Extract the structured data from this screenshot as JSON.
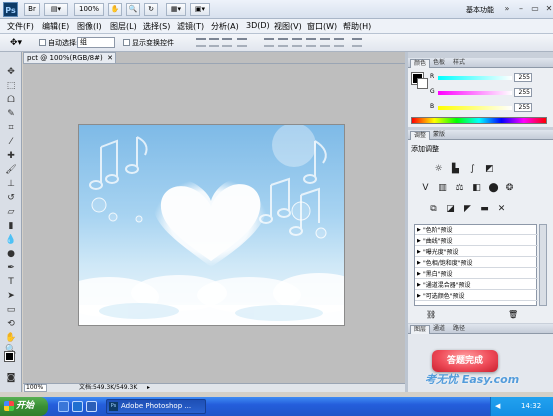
{
  "app": {
    "logo_text": "Ps",
    "zoom_select": "100%",
    "workspace_label": "基本功能"
  },
  "menu": [
    "文件(F)",
    "编辑(E)",
    "图像(I)",
    "图层(L)",
    "选择(S)",
    "滤镜(T)",
    "分析(A)",
    "3D(D)",
    "视图(V)",
    "窗口(W)",
    "帮助(H)"
  ],
  "options": {
    "auto_select_label": "自动选择:",
    "auto_select_value": "组",
    "show_transform_label": "显示变换控件"
  },
  "document": {
    "tab_label": "pct @ 100%(RGB/8#)",
    "status_zoom": "100%",
    "status_doc": "文档:549.3K/549.3K"
  },
  "color_panel": {
    "tabs": [
      "颜色",
      "色板",
      "样式"
    ],
    "channels": [
      {
        "label": "R",
        "value": "255"
      },
      {
        "label": "G",
        "value": "255"
      },
      {
        "label": "B",
        "value": "255"
      }
    ]
  },
  "adjust_panel": {
    "tabs": [
      "调整",
      "蒙版"
    ],
    "title": "添加调整",
    "presets": [
      "\"色阶\"预设",
      "\"曲线\"预设",
      "\"曝光度\"预设",
      "\"色相/饱和度\"预设",
      "\"黑白\"预设",
      "\"通道混合器\"预设",
      "\"可选颜色\"预设"
    ]
  },
  "layers_panel": {
    "tabs": [
      "图层",
      "通道",
      "路径"
    ]
  },
  "overlay": {
    "done_button": "答题完成",
    "watermark": "考无忧 Easy.com"
  },
  "taskbar": {
    "start": "开始",
    "task_label": "Adobe Photoshop ...",
    "time": "14:32"
  }
}
